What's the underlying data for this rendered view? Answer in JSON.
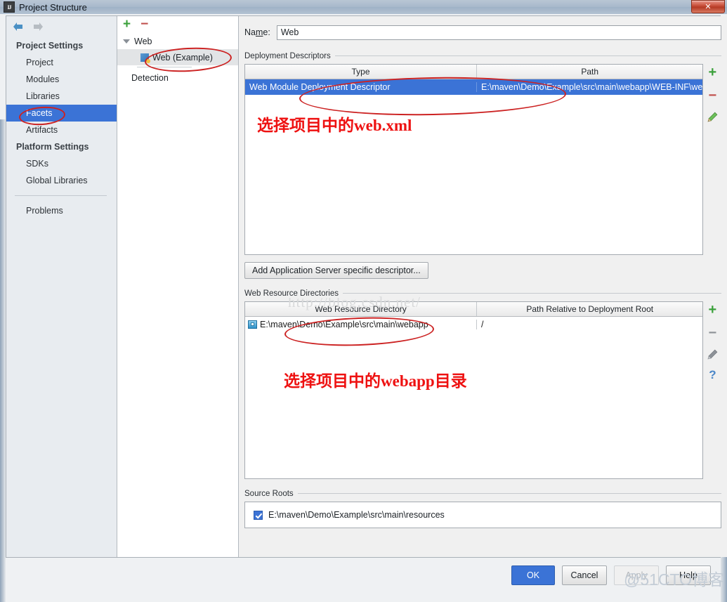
{
  "window": {
    "title": "Project Structure",
    "app_icon": "IJ",
    "close_label": "✕"
  },
  "sidebar": {
    "back_icon": "arrow-left-icon",
    "forward_icon": "arrow-right-icon",
    "groups": [
      {
        "label": "Project Settings",
        "items": [
          {
            "label": "Project",
            "selected": false
          },
          {
            "label": "Modules",
            "selected": false
          },
          {
            "label": "Libraries",
            "selected": false
          },
          {
            "label": "Facets",
            "selected": true
          },
          {
            "label": "Artifacts",
            "selected": false
          }
        ]
      },
      {
        "label": "Platform Settings",
        "items": [
          {
            "label": "SDKs",
            "selected": false
          },
          {
            "label": "Global Libraries",
            "selected": false
          }
        ]
      }
    ],
    "footer_items": [
      {
        "label": "Problems"
      }
    ]
  },
  "tree": {
    "toolbar": {
      "add": "+",
      "remove": "−"
    },
    "nodes": [
      {
        "label": "Web",
        "type": "root",
        "expanded": true
      },
      {
        "label": "Web (Example)",
        "type": "facet",
        "selected": true
      },
      {
        "label": "Detection",
        "type": "plain"
      }
    ]
  },
  "main": {
    "name_label_pre": "Na",
    "name_label_mid": "m",
    "name_label_post": "e:",
    "name_value": "Web",
    "deployment": {
      "group_title": "Deployment Descriptors",
      "columns": [
        "Type",
        "Path"
      ],
      "rows": [
        {
          "type": "Web Module Deployment Descriptor",
          "path": "E:\\maven\\Demo\\Example\\src\\main\\webapp\\WEB-INF\\we",
          "selected": true
        }
      ],
      "tools": [
        "add-icon",
        "remove-icon",
        "edit-icon"
      ],
      "add_button": "Add Application Server specific descriptor..."
    },
    "web_resources": {
      "group_title": "Web Resource Directories",
      "columns": [
        "Web Resource Directory",
        "Path Relative to Deployment Root"
      ],
      "rows": [
        {
          "directory": "E:\\maven\\Demo\\Example\\src\\main\\webapp",
          "relative_path": "/"
        }
      ],
      "tools": [
        "add-icon",
        "remove-icon",
        "edit-icon",
        "help-icon"
      ]
    },
    "source_roots": {
      "group_title": "Source Roots",
      "rows": [
        {
          "path": "E:\\maven\\Demo\\Example\\src\\main\\resources",
          "checked": true
        }
      ]
    }
  },
  "footer": {
    "ok": "OK",
    "cancel": "Cancel",
    "apply": "Apply",
    "help": "Help"
  },
  "annotations": [
    {
      "text": "选择项目中的web.xml"
    },
    {
      "text": "选择项目中的webapp目录"
    }
  ],
  "watermarks": {
    "csdn": "http://blog.csdn.net/",
    "cto": "@51CTO博客"
  }
}
